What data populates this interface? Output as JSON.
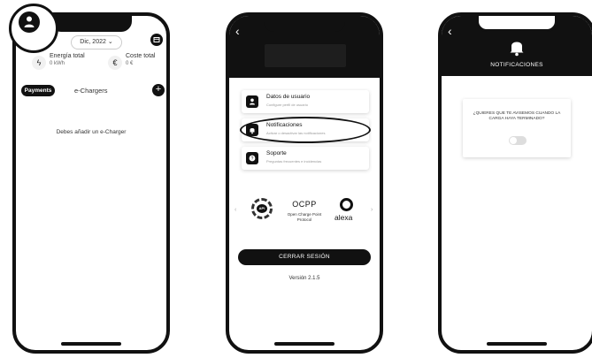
{
  "screen1": {
    "date_selector": "Dic, 2022",
    "energy_label": "Energía total",
    "energy_value": "0 kWh",
    "cost_label": "Coste total",
    "cost_value": "0 €",
    "payments_label": "Payments",
    "echargers_label": "e-Chargers",
    "empty_message": "Debes añadir un e-Charger"
  },
  "screen2": {
    "menu": [
      {
        "title": "Datos de usuario",
        "subtitle": "Configure perfil de usuario",
        "icon": "user-icon"
      },
      {
        "title": "Notificaciones",
        "subtitle": "Activar o desactivar las notificaciones",
        "icon": "bell-icon"
      },
      {
        "title": "Soporte",
        "subtitle": "Preguntas frecuentes e incidencias",
        "icon": "help-icon"
      }
    ],
    "ocpp_title": "OCPP",
    "ocpp_subtitle": "Open Charge Point Protocol",
    "api_label": "API",
    "alexa_label": "alexa",
    "logout_label": "CERRAR SESIÓN",
    "version": "Versión 2.1.5"
  },
  "screen3": {
    "title": "NOTIFICACIONES",
    "question": "¿QUIERES QUE TE AVISEMOS CUANDO LA CARGA HAYA TERMINADO?",
    "toggle_on": false
  }
}
